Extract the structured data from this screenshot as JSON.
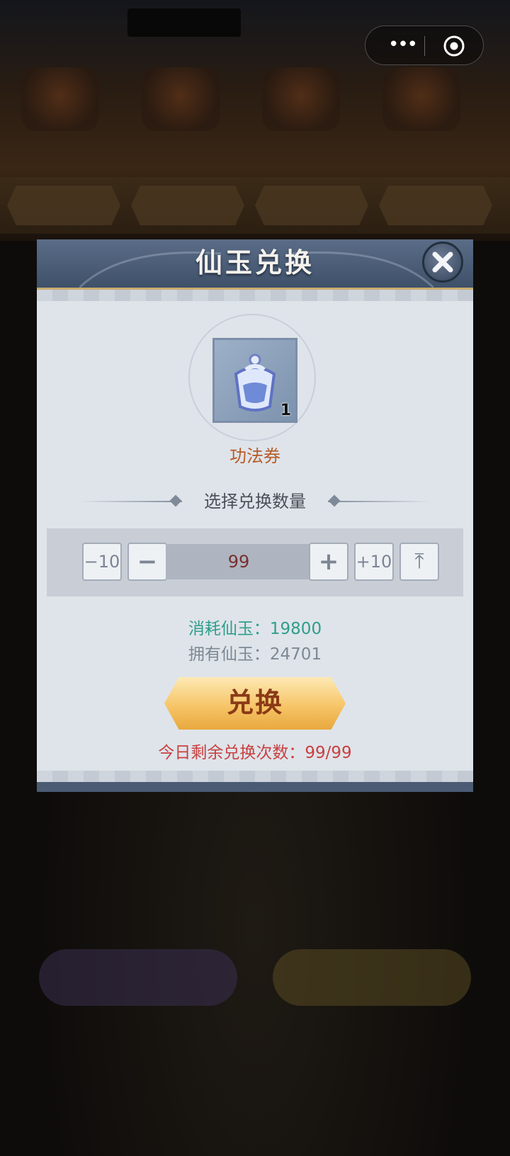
{
  "dialog": {
    "title": "仙玉兑换",
    "item": {
      "name": "功法券",
      "count": "1",
      "icon": "scroll-ticket-icon"
    },
    "quantity_label": "选择兑换数量",
    "stepper": {
      "minus10": "−10",
      "minus": "−",
      "value": "99",
      "plus": "+",
      "plus10": "+10",
      "max": "⤒"
    },
    "cost": "消耗仙玉：19800",
    "owned": "拥有仙玉：24701",
    "exchange_button": "兑换",
    "remaining": "今日剩余兑换次数：99/99"
  },
  "capsule": {
    "more": "•••"
  },
  "colors": {
    "header": "#4a5b73",
    "accent_gold": "#f6c568",
    "cost_green": "#2f9e8a",
    "remaining_red": "#c84040",
    "item_name": "#b85a26"
  }
}
